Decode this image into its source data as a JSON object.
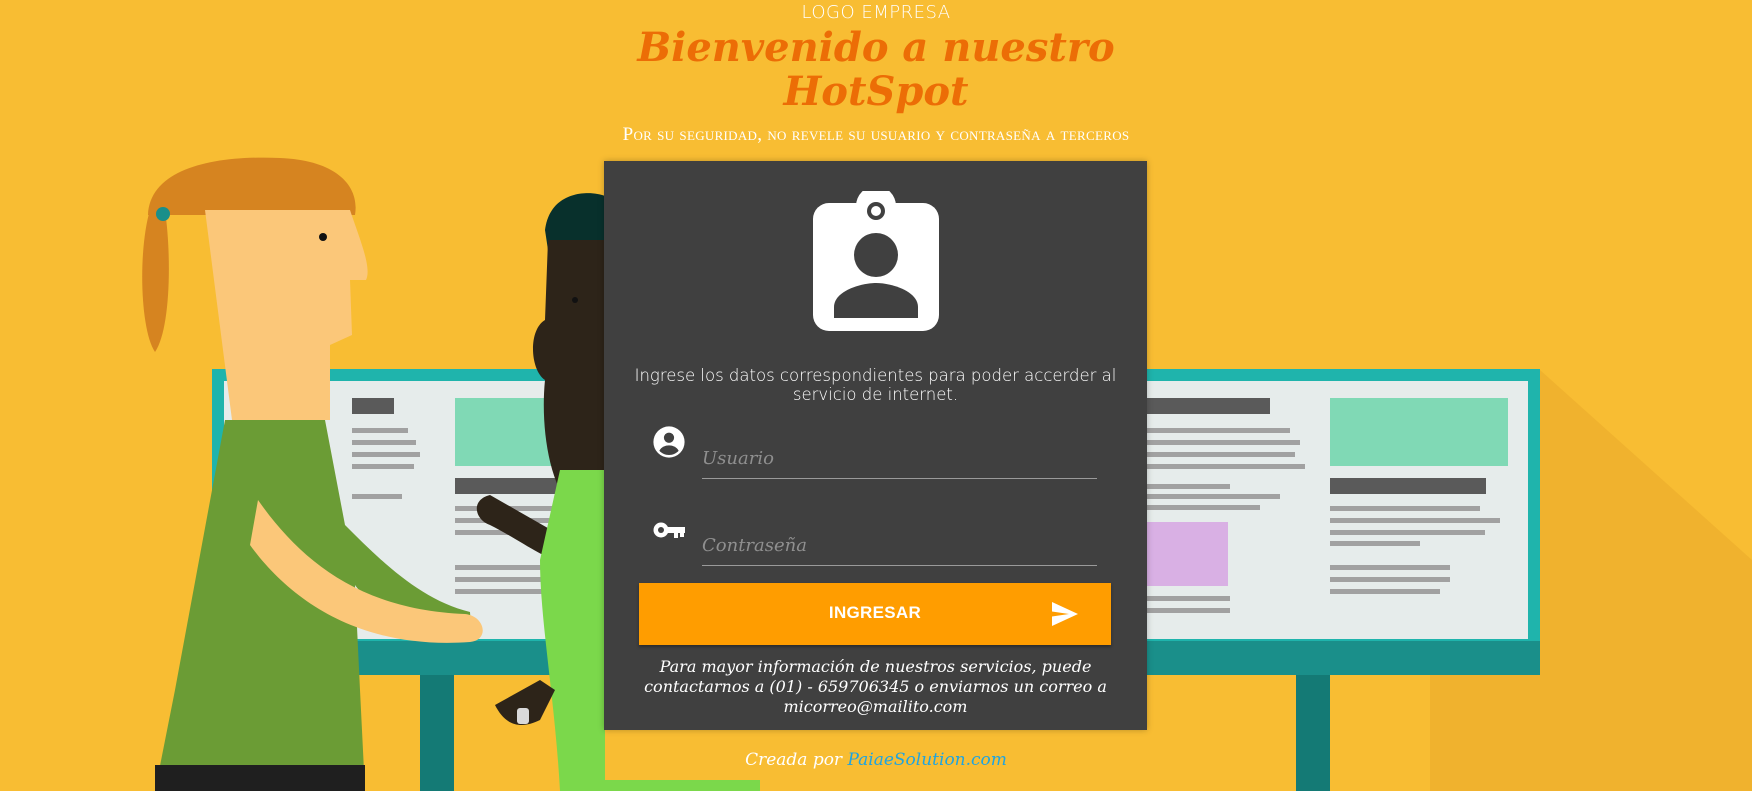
{
  "header": {
    "logo_text": "LOGO EMPRESA",
    "title_line1": "Bienvenido a nuestro",
    "title_line2": "HotSpot",
    "subtitle": "Por su seguridad, no revele su usuario y contraseña a terceros"
  },
  "login_card": {
    "instructions": "Ingrese los datos correspondientes para poder accerder al servicio de internet.",
    "username": {
      "placeholder": "Usuario",
      "value": "",
      "icon": "account-circle-icon"
    },
    "password": {
      "placeholder": "Contraseña",
      "value": "",
      "icon": "key-icon"
    },
    "submit_label": "INGRESAR",
    "submit_icon": "send-icon",
    "contact_info": "Para mayor información de nuestros servicios, puede contactarnos a (01) - 659706345 o enviarnos un correo a micorreo@mailito.com"
  },
  "footer": {
    "credit_prefix": "Creada por",
    "credit_link": "PaiaeSolution.com"
  },
  "colors": {
    "background": "#f8bd33",
    "card": "#404040",
    "title": "#ec6d06",
    "button": "#ff9d00",
    "link": "#1fa4e0"
  }
}
